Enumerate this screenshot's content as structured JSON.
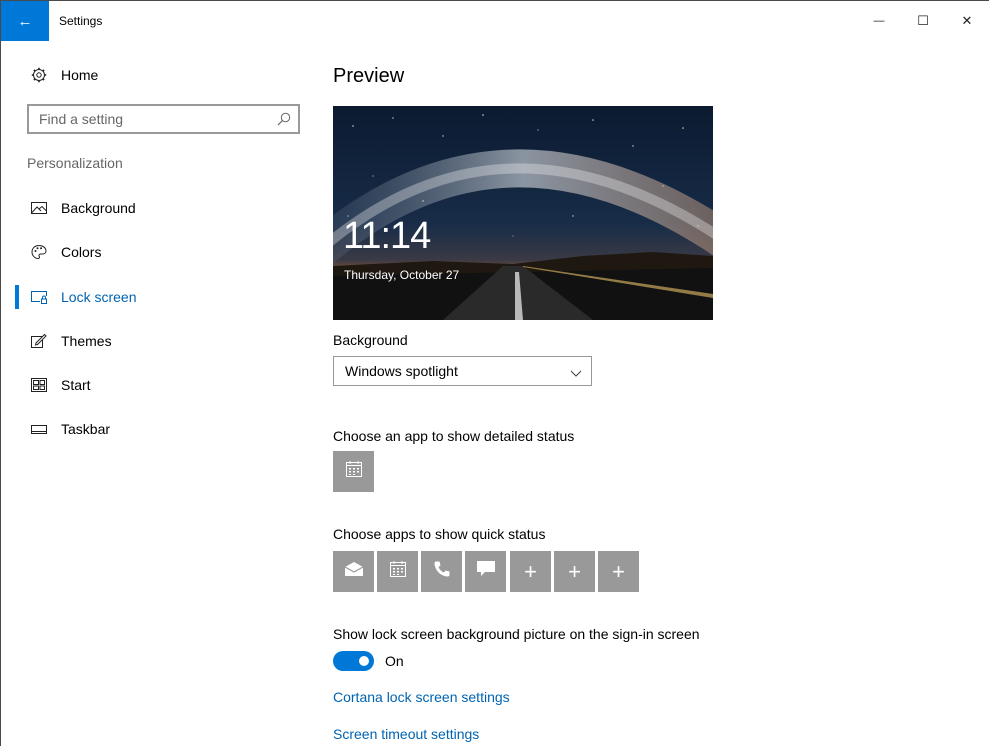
{
  "window": {
    "title": "Settings",
    "back_glyph": "←",
    "minimize_glyph": "—",
    "maximize_glyph": "☐",
    "close_glyph": "✕"
  },
  "sidebar": {
    "home_label": "Home",
    "search": {
      "placeholder": "Find a setting"
    },
    "section_label": "Personalization",
    "items": [
      {
        "label": "Background",
        "icon": "picture-icon",
        "active": false
      },
      {
        "label": "Colors",
        "icon": "palette-icon",
        "active": false
      },
      {
        "label": "Lock screen",
        "icon": "lock-screen-icon",
        "active": true
      },
      {
        "label": "Themes",
        "icon": "themes-icon",
        "active": false
      },
      {
        "label": "Start",
        "icon": "start-icon",
        "active": false
      },
      {
        "label": "Taskbar",
        "icon": "taskbar-icon",
        "active": false
      }
    ]
  },
  "main": {
    "preview_title": "Preview",
    "preview": {
      "time": "11:14",
      "date": "Thursday, October 27"
    },
    "background_label": "Background",
    "background_value": "Windows spotlight",
    "detailed_status_label": "Choose an app to show detailed status",
    "detailed_status_app": "calendar-icon",
    "quick_status_label": "Choose apps to show quick status",
    "quick_status_apps": [
      "mail-icon",
      "calendar-icon",
      "phone-icon",
      "message-icon",
      "add-icon",
      "add-icon",
      "add-icon"
    ],
    "plus_glyph": "+",
    "show_bg_label": "Show lock screen background picture on the sign-in screen",
    "toggle_state": "On",
    "cortana_link": "Cortana lock screen settings",
    "timeout_link": "Screen timeout settings"
  },
  "colors": {
    "accent": "#0078d7",
    "link": "#0063b1",
    "tile": "#999999"
  }
}
